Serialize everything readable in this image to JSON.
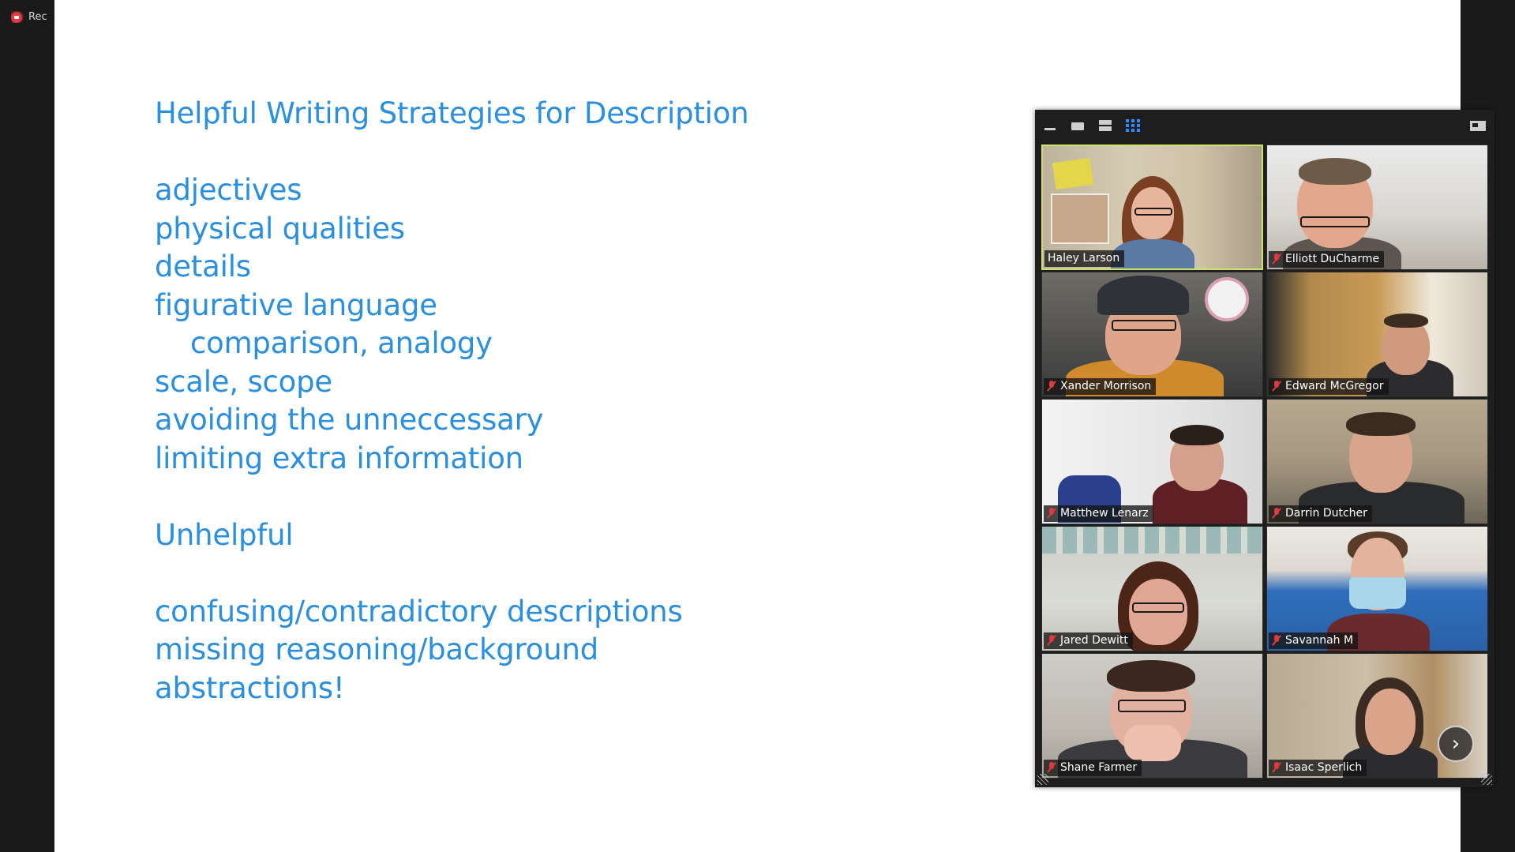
{
  "recording": {
    "label": "Rec"
  },
  "slide": {
    "lines": [
      "Helpful Writing Strategies for Description",
      "",
      "adjectives",
      "physical qualities",
      "details",
      "figurative language",
      "comparison, analogy",
      "scale, scope",
      "avoiding the unneccessary",
      "limiting extra information",
      "",
      "Unhelpful",
      "",
      "confusing/contradictory descriptions",
      "missing reasoning/background",
      "abstractions!"
    ]
  },
  "gallery": {
    "toolbar": {
      "minimize_icon": "minimize-icon",
      "single_icon": "speaker-view-icon",
      "strip_icon": "strip-view-icon",
      "grid_icon": "gallery-grid-icon",
      "exit_icon": "exit-fullscreen-icon"
    },
    "participants": [
      {
        "name": "Haley Larson",
        "muted": false,
        "active": true
      },
      {
        "name": "Elliott DuCharme",
        "muted": true
      },
      {
        "name": "Xander Morrison",
        "muted": true
      },
      {
        "name": "Edward McGregor",
        "muted": true
      },
      {
        "name": "Matthew Lenarz",
        "muted": true
      },
      {
        "name": "Darrin Dutcher",
        "muted": true
      },
      {
        "name": "Jared Dewitt",
        "muted": true
      },
      {
        "name": "Savannah M",
        "muted": true
      },
      {
        "name": "Shane Farmer",
        "muted": true
      },
      {
        "name": "Isaac Sperlich",
        "muted": true
      }
    ],
    "next_button": "›"
  },
  "colors": {
    "slide_text": "#2b8fe0",
    "active_speaker_border": "#c9e36b",
    "mute_red": "#e0393e",
    "grid_blue": "#2d8cff"
  }
}
